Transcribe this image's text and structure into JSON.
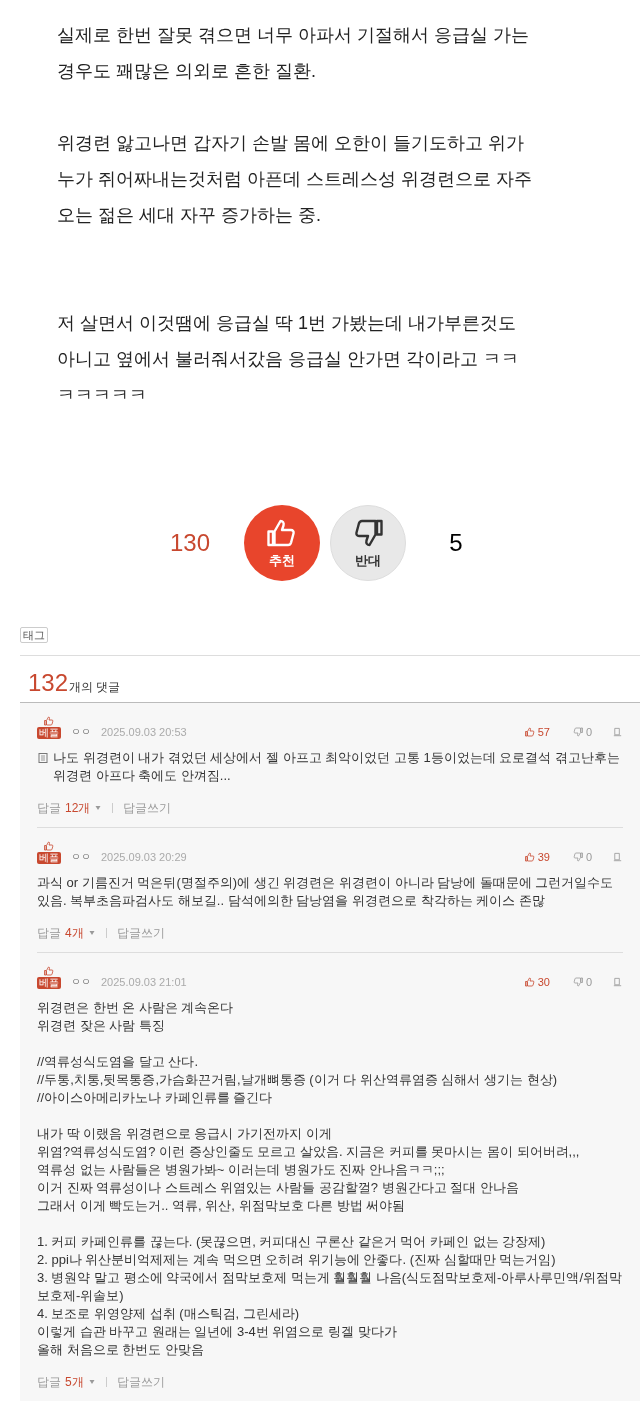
{
  "article": {
    "paragraphs": [
      "실제로 한번 잘못 겪으면 너무 아파서 기절해서 응급실 가는 경우도 꽤많은 의외로 흔한 질환.",
      "위경련 앓고나면 갑자기 손발 몸에 오한이 들기도하고 위가 누가 쥐어짜내는것처럼 아픈데 스트레스성 위경련으로 자주 오는 젊은 세대 자꾸 증가하는 중.",
      "저 살면서 이것땜에 응급실 딱 1번 가봤는데 내가부른것도 아니고 옆에서 불러줘서갔음 응급실 안가면 각이라고 ㅋㅋㅋㅋㅋㅋㅋ"
    ]
  },
  "vote": {
    "likes": "130",
    "like_label": "추천",
    "dislike_label": "반대",
    "dislikes": "5"
  },
  "tag_label": "태그",
  "comment_count": {
    "number": "132",
    "suffix": "개의 댓글"
  },
  "comments": [
    {
      "badge": "베플",
      "nickname": "ㅇㅇ",
      "date": "2025.09.03 20:53",
      "likes": "57",
      "dislikes": "0",
      "note_icon": true,
      "body": "나도 위경련이 내가 겪었던 세상에서 젤 아프고 최악이었던 고통 1등이었는데 요로결석 겪고난후는 위경련 아프다 축에도 안껴짐...",
      "reply_label": "답글",
      "reply_count": "12개",
      "write_label": "답글쓰기"
    },
    {
      "badge": "베플",
      "nickname": "ㅇㅇ",
      "date": "2025.09.03 20:29",
      "likes": "39",
      "dislikes": "0",
      "note_icon": false,
      "body": "과식 or 기름진거 먹은뒤(명절주의)에 생긴 위경련은 위경련이 아니라 담낭에 돌때문에 그런거일수도 있음. 복부초음파검사도 해보길.. 담석에의한 담낭염을 위경련으로 착각하는 케이스 존많",
      "reply_label": "답글",
      "reply_count": "4개",
      "write_label": "답글쓰기"
    },
    {
      "badge": "베플",
      "nickname": "ㅇㅇ",
      "date": "2025.09.03 21:01",
      "likes": "30",
      "dislikes": "0",
      "note_icon": false,
      "body": "위경련은 한번 온 사람은 계속온다\n위경련 잦은 사람 특징\n\n//역류성식도염을 달고 산다.\n//두통,치통,뒷목통증,가슴화끈거림,날개뼈통증 (이거 다 위산역류염증 심해서 생기는 현상)\n//아이스아메리카노나 카페인류를 즐긴다\n\n내가 딱 이랬음 위경련으로 응급시 가기전까지 이게\n위염?역류성식도염? 이런 증상인줄도 모르고 살았음. 지금은 커피를 못마시는 몸이 되어버려,,,\n역류성 없는 사람들은 병원가봐~ 이러는데 병원가도 진짜 안나음ㅋㅋ;;;\n이거 진짜 역류성이나 스트레스 위염있는 사람들 공감할껄? 병원간다고 절대 안나음\n그래서 이게 빡도는거.. 역류, 위산, 위점막보호 다른 방법 써야됨\n\n1. 커피 카페인류를 끊는다. (못끊으면, 커피대신 구론산 같은거 먹어 카페인 없는 강장제)\n2. ppi나 위산분비억제제는 계속 먹으면 오히려 위기능에 안좋다. (진짜 심할때만 먹는거임)\n3. 병원약 말고 평소에 약국에서 점막보호제 먹는게 훨훨훨 나음(식도점막보호제-아루사루민액/위점막보호제-위솔보)\n4. 보조로 위영양제 섭취 (매스틱검, 그린세라)\n이렇게 습관 바꾸고 원래는 일년에 3-4번 위염으로 링겔 맞다가\n올해 처음으로 한번도 안맞음",
      "reply_label": "답글",
      "reply_count": "5개",
      "write_label": "답글쓰기"
    }
  ]
}
